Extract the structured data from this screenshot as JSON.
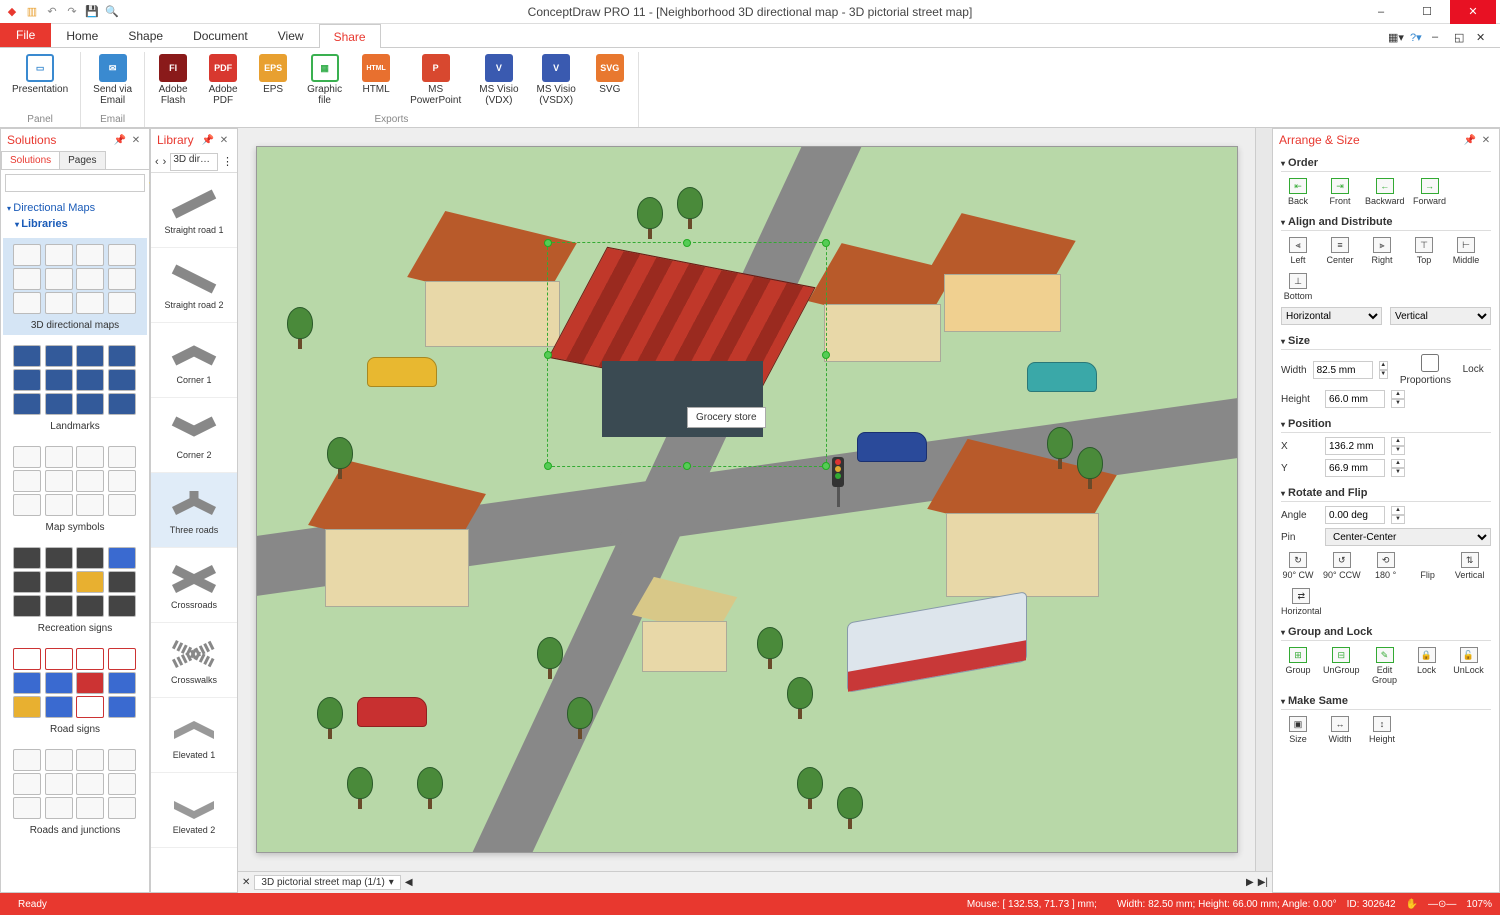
{
  "app": {
    "title": "ConceptDraw PRO 11 - [Neighborhood 3D directional map - 3D pictorial street map]"
  },
  "ribbon": {
    "file": "File",
    "tabs": [
      "Home",
      "Shape",
      "Document",
      "View",
      "Share"
    ],
    "active_tab": "Share",
    "groups": {
      "panel_label": "Panel",
      "email_label": "Email",
      "exports_label": "Exports",
      "presentation": "Presentation",
      "send_email": "Send via\nEmail",
      "adobe_flash": "Adobe\nFlash",
      "adobe_pdf": "Adobe\nPDF",
      "eps": "EPS",
      "graphic_file": "Graphic\nfile",
      "html": "HTML",
      "ms_ppt": "MS\nPowerPoint",
      "ms_visio_vdx": "MS Visio\n(VDX)",
      "ms_visio_vsdx": "MS Visio\n(VSDX)",
      "svg": "SVG"
    }
  },
  "solutions": {
    "title": "Solutions",
    "tabs": [
      "Solutions",
      "Pages"
    ],
    "tree": {
      "n0": "Directional Maps",
      "n1": "Libraries"
    },
    "cats": {
      "c0": "3D directional maps",
      "c1": "Landmarks",
      "c2": "Map symbols",
      "c3": "Recreation signs",
      "c4": "Road signs",
      "c5": "Roads and junctions"
    }
  },
  "library": {
    "title": "Library",
    "dropdown": "3D dire…",
    "items": {
      "i0": "Straight road 1",
      "i1": "Straight road 2",
      "i2": "Corner 1",
      "i3": "Corner 2",
      "i4": "Three roads",
      "i5": "Crossroads",
      "i6": "Crosswalks",
      "i7": "Elevated 1",
      "i8": "Elevated 2"
    }
  },
  "canvas": {
    "annotation": "Grocery store",
    "doc_tab": "3D pictorial street map (1/1)"
  },
  "arrange": {
    "title": "Arrange & Size",
    "order": {
      "h": "Order",
      "back": "Back",
      "front": "Front",
      "backward": "Backward",
      "forward": "Forward"
    },
    "align": {
      "h": "Align and Distribute",
      "left": "Left",
      "center": "Center",
      "right": "Right",
      "top": "Top",
      "middle": "Middle",
      "bottom": "Bottom",
      "horizontal": "Horizontal",
      "vertical": "Vertical"
    },
    "size": {
      "h": "Size",
      "width_l": "Width",
      "height_l": "Height",
      "width": "82.5 mm",
      "height": "66.0 mm",
      "lock": "Lock Proportions"
    },
    "pos": {
      "h": "Position",
      "x_l": "X",
      "y_l": "Y",
      "x": "136.2 mm",
      "y": "66.9 mm"
    },
    "rotate": {
      "h": "Rotate and Flip",
      "angle_l": "Angle",
      "angle": "0.00 deg",
      "pin_l": "Pin",
      "pin": "Center-Center",
      "cw": "90° CW",
      "ccw": "90° CCW",
      "r180": "180 °",
      "flip": "Flip",
      "vert": "Vertical",
      "horiz": "Horizontal"
    },
    "group": {
      "h": "Group and Lock",
      "group": "Group",
      "ungroup": "UnGroup",
      "edit": "Edit\nGroup",
      "lock": "Lock",
      "unlock": "UnLock"
    },
    "make": {
      "h": "Make Same",
      "size": "Size",
      "width": "Width",
      "height": "Height"
    }
  },
  "status": {
    "ready": "Ready",
    "mouse": "Mouse: [ 132.53, 71.73 ] mm;",
    "dims": "Width: 82.50 mm;   Height: 66.00 mm;   Angle: 0.00°",
    "id": "ID: 302642",
    "zoom": "107%"
  }
}
